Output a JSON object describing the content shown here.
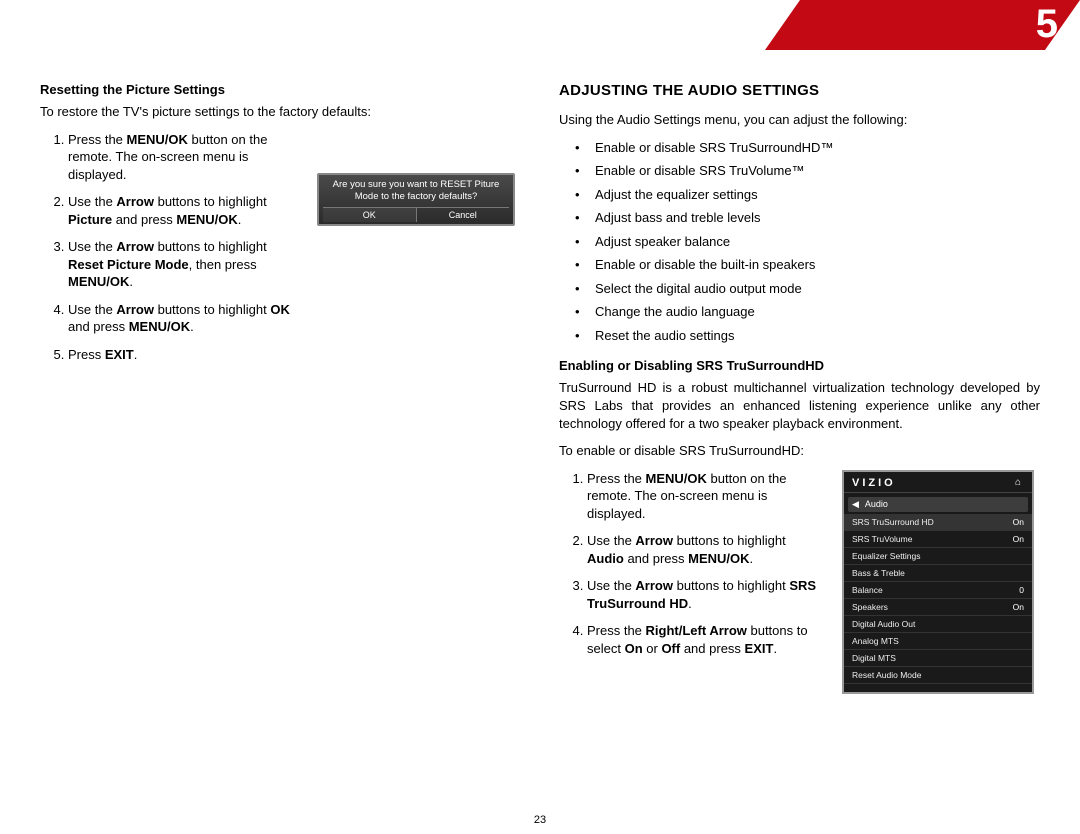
{
  "chapter_number": "5",
  "page_number": "23",
  "left": {
    "sub_heading": "Resetting the Picture Settings",
    "intro": "To restore the TV's picture settings to the factory defaults:",
    "steps": {
      "s1a": "Press the ",
      "s1b": "MENU/OK",
      "s1c": " button on the remote. The on-screen menu is displayed.",
      "s2a": "Use the ",
      "s2b": "Arrow",
      "s2c": " buttons to highlight ",
      "s2d": "Picture",
      "s2e": " and press ",
      "s2f": "MENU/OK",
      "s2g": ".",
      "s3a": "Use the ",
      "s3b": "Arrow",
      "s3c": " buttons to highlight ",
      "s3d": "Reset Picture Mode",
      "s3e": ", then press ",
      "s3f": "MENU/OK",
      "s3g": ".",
      "s4a": "Use the ",
      "s4b": "Arrow",
      "s4c": " buttons to highlight ",
      "s4d": "OK",
      "s4e": " and press ",
      "s4f": "MENU/OK",
      "s4g": ".",
      "s5a": "Press ",
      "s5b": "EXIT",
      "s5c": "."
    },
    "dialog": {
      "line1": "Are you sure you want to RESET Piture",
      "line2": "Mode to the factory defaults?",
      "ok": "OK",
      "cancel": "Cancel"
    }
  },
  "right": {
    "section_title": "ADJUSTING THE AUDIO SETTINGS",
    "intro": "Using the Audio Settings menu, you can adjust the following:",
    "bullets": {
      "b1": "Enable or disable SRS TruSurroundHD™",
      "b2": "Enable or disable SRS TruVolume™",
      "b3": "Adjust the equalizer settings",
      "b4": "Adjust bass and treble levels",
      "b5": "Adjust speaker balance",
      "b6": "Enable or disable the built-in speakers",
      "b7": "Select the digital audio output mode",
      "b8": "Change the audio language",
      "b9": "Reset the audio settings"
    },
    "sub_heading2": "Enabling or Disabling SRS TruSurroundHD",
    "para": "TruSurround HD is a robust multichannel virtualization technology developed by SRS Labs that provides an enhanced listening experience unlike any other technology offered for a two speaker playback environment.",
    "intro2": "To enable or disable SRS TruSurroundHD:",
    "steps": {
      "s1a": "Press the ",
      "s1b": "MENU/OK",
      "s1c": " button on the remote. The on-screen menu is displayed.",
      "s2a": "Use the ",
      "s2b": "Arrow",
      "s2c": " buttons to highlight ",
      "s2d": "Audio",
      "s2e": " and press ",
      "s2f": "MENU/OK",
      "s2g": ".",
      "s3a": "Use the ",
      "s3b": "Arrow",
      "s3c": " buttons to highlight ",
      "s3d": "SRS TruSurround HD",
      "s3e": ".",
      "s4a": "Press the ",
      "s4b": "Right/Left Arrow",
      "s4c": " buttons to select ",
      "s4d": "On",
      "s4e": " or ",
      "s4f": "Off",
      "s4g": " and press ",
      "s4h": "EXIT",
      "s4i": "."
    },
    "osd": {
      "brand": "VIZIO",
      "home_glyph": "⌂",
      "back_glyph": "◀",
      "crumb": "Audio",
      "rows": [
        {
          "k": "SRS TruSurround HD",
          "v": "On"
        },
        {
          "k": "SRS TruVolume",
          "v": "On"
        },
        {
          "k": "Equalizer Settings",
          "v": ""
        },
        {
          "k": "Bass & Treble",
          "v": ""
        },
        {
          "k": "Balance",
          "v": "0"
        },
        {
          "k": "Speakers",
          "v": "On"
        },
        {
          "k": "Digital Audio Out",
          "v": ""
        },
        {
          "k": "Analog MTS",
          "v": ""
        },
        {
          "k": "Digital MTS",
          "v": ""
        },
        {
          "k": "Reset Audio Mode",
          "v": ""
        }
      ]
    }
  }
}
